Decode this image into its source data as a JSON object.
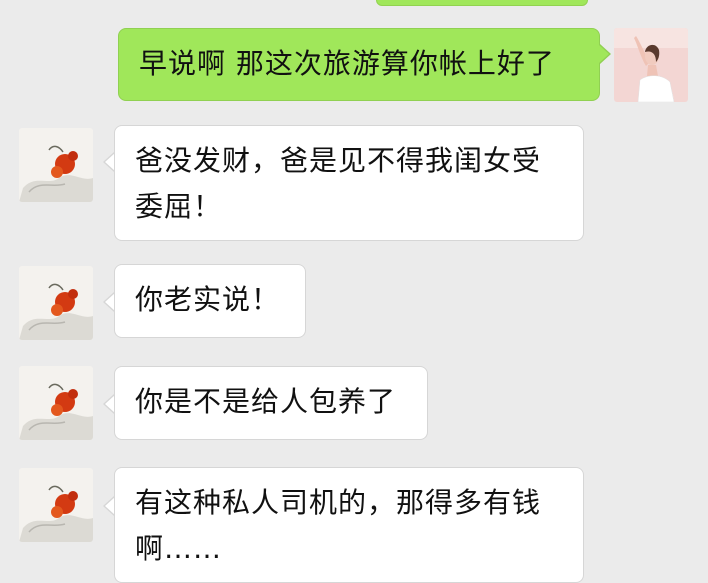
{
  "conversation": {
    "messages": [
      {
        "direction": "outgoing",
        "text": "早说啊 那这次旅游算你帐上好了"
      },
      {
        "direction": "incoming",
        "text": "爸没发财，爸是见不得我闺女受委屈！"
      },
      {
        "direction": "incoming",
        "text": "你老实说！"
      },
      {
        "direction": "incoming",
        "text": "你是不是给人包养了"
      },
      {
        "direction": "incoming",
        "text": "有这种私人司机的，那得多有钱啊……"
      }
    ]
  }
}
